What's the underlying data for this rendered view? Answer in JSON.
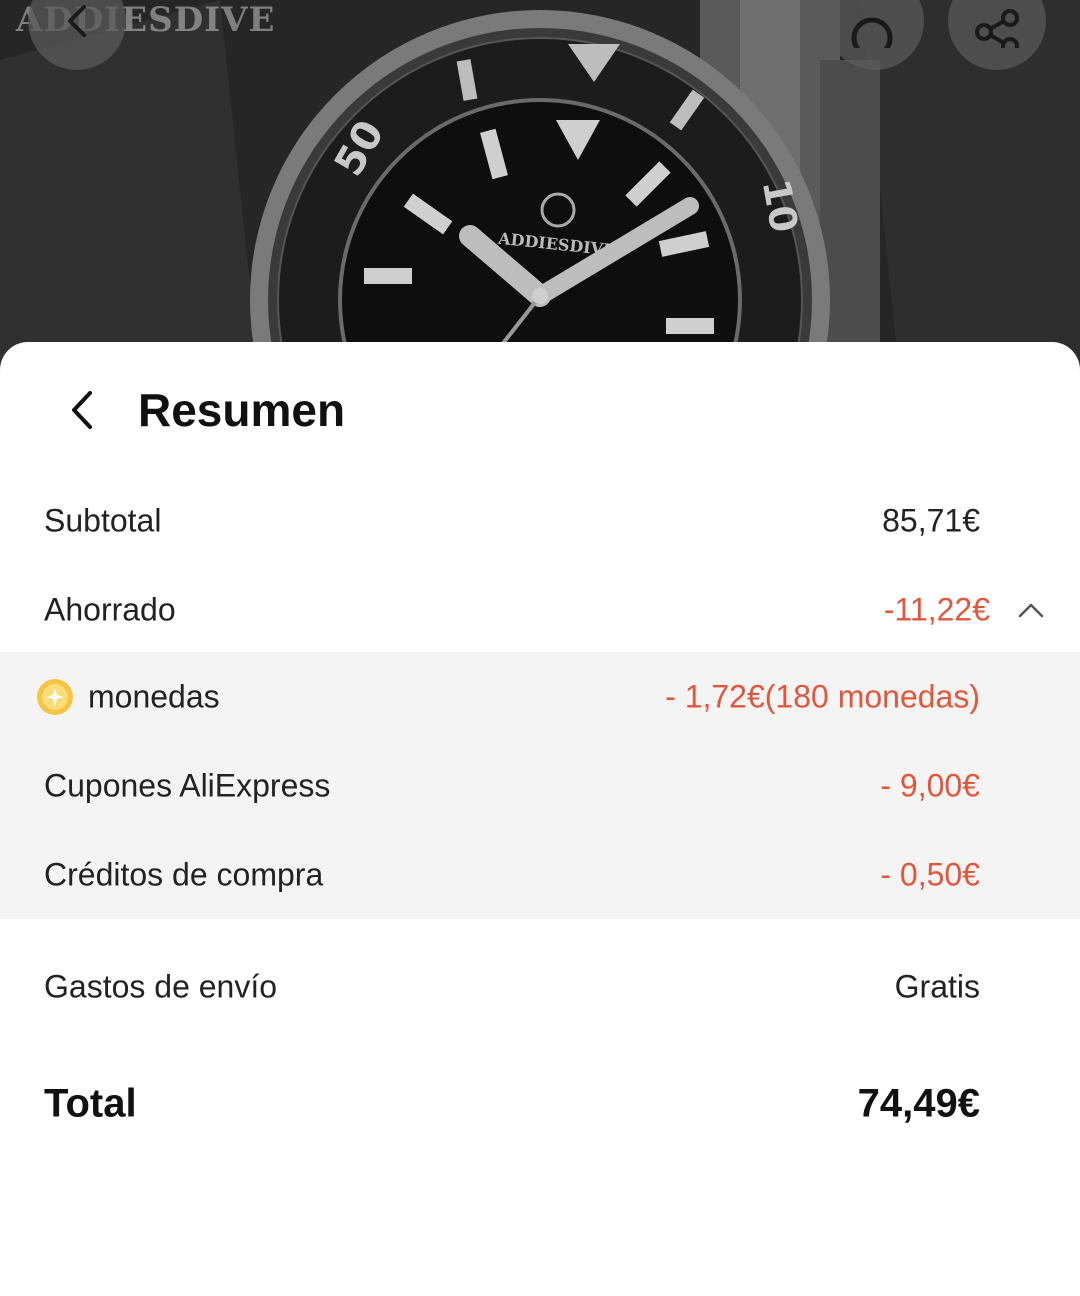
{
  "backdrop": {
    "watermark": "ADDIESDIVE",
    "dial_brand": "ADDIESDIVE",
    "bezel_numbers": [
      "50",
      "10"
    ]
  },
  "sheet": {
    "title": "Resumen"
  },
  "summary": {
    "subtotal": {
      "label": "Subtotal",
      "value": "85,71€"
    },
    "saved": {
      "label": "Ahorrado",
      "value": "-11,22€"
    },
    "discounts": [
      {
        "label": "monedas",
        "value": "- 1,72€(180 monedas)",
        "icon": "coin-icon"
      },
      {
        "label": "Cupones AliExpress",
        "value": "- 9,00€"
      },
      {
        "label": "Créditos de compra",
        "value": "- 0,50€"
      }
    ],
    "shipping": {
      "label": "Gastos de envío",
      "value": "Gratis"
    },
    "total": {
      "label": "Total",
      "value": "74,49€"
    }
  },
  "colors": {
    "discount_red": "#e0573c",
    "group_bg": "#f4f4f4",
    "coin_gold": "#f5c542"
  }
}
